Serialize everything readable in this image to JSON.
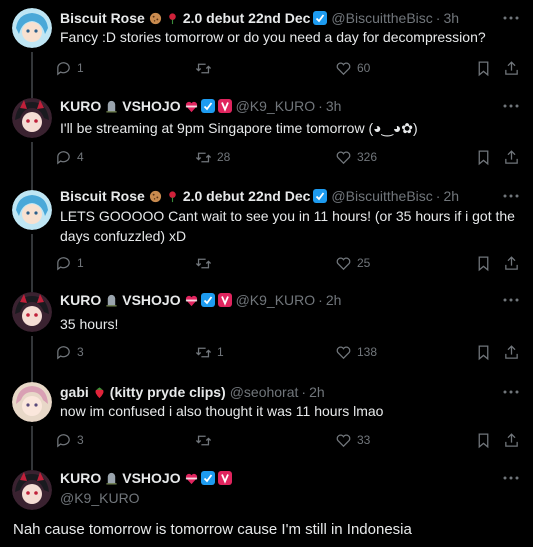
{
  "tweets": [
    {
      "name": "Biscuit Rose",
      "name_suffix": "2.0 debut 22nd Dec",
      "handle": "@BiscuittheBisc",
      "time": "3h",
      "text": "Fancy :D stories tomorrow or do you need a day for decompression?",
      "replies": "1",
      "retweets": "",
      "likes": "60",
      "avatar": "biscuit"
    },
    {
      "name": "KURO",
      "name_suffix": "VSHOJO",
      "handle": "@K9_KURO",
      "time": "3h",
      "text": "I'll be streaming at 9pm Singapore time tomorrow (◕‿◕✿)",
      "replies": "4",
      "retweets": "28",
      "likes": "326",
      "avatar": "kuro"
    },
    {
      "name": "Biscuit Rose",
      "name_suffix": "2.0 debut 22nd Dec",
      "handle": "@BiscuittheBisc",
      "time": "2h",
      "text": "LETS GOOOOO Cant wait to see you in 11 hours! (or 35 hours if i got the days confuzzled) xD",
      "replies": "1",
      "retweets": "",
      "likes": "25",
      "avatar": "biscuit"
    },
    {
      "name": "KURO",
      "name_suffix": "VSHOJO",
      "handle": "@K9_KURO",
      "time": "2h",
      "text": "35 hours!",
      "replies": "3",
      "retweets": "1",
      "likes": "138",
      "avatar": "kuro"
    },
    {
      "name": "gabi",
      "name_suffix": "(kitty pryde clips)",
      "handle": "@seohorat",
      "time": "2h",
      "text": "now im confused i also thought it was 11 hours lmao",
      "replies": "3",
      "retweets": "",
      "likes": "33",
      "avatar": "gabi"
    }
  ],
  "main_tweet": {
    "name": "KURO",
    "name_suffix": "VSHOJO",
    "handle": "@K9_KURO",
    "text": "Nah cause tomorrow is tomorrow cause I'm still in Indonesia"
  },
  "colors": {
    "background": "#000000",
    "text": "#e7e9ea",
    "muted": "#71767b",
    "verified": "#1d9bf0",
    "vshojo_pink": "#e0245e"
  }
}
